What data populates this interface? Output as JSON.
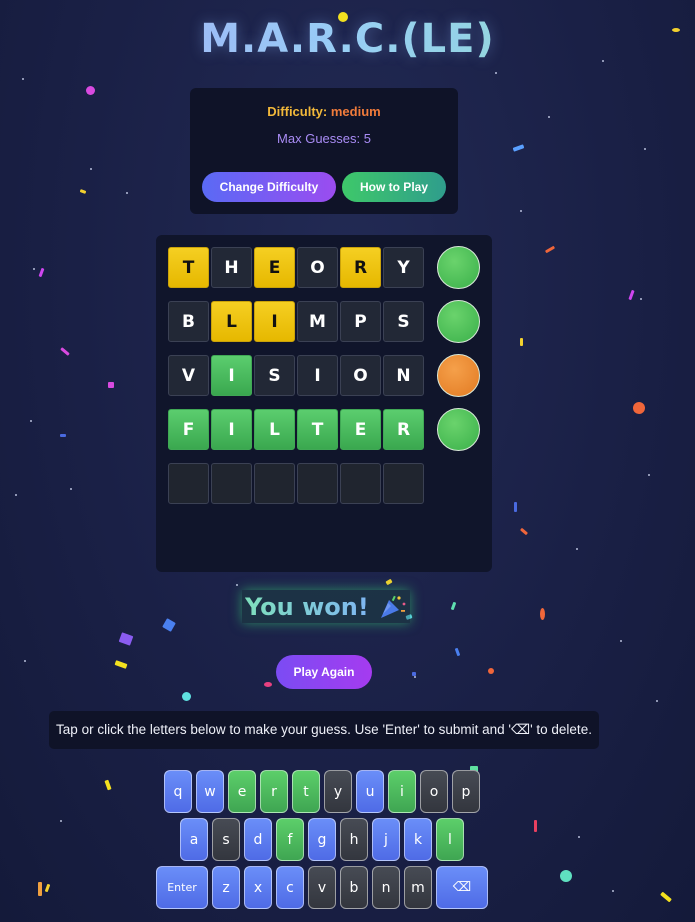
{
  "app": {
    "title": "M.A.R.C.(LE)"
  },
  "difficulty": {
    "label": "Difficulty:",
    "value": "medium",
    "max_guesses_text": "Max Guesses: 5",
    "change_button": "Change Difficulty",
    "how_button": "How to Play"
  },
  "board": {
    "rows": [
      {
        "letters": [
          "T",
          "H",
          "E",
          "O",
          "R",
          "Y"
        ],
        "states": [
          "y",
          "d",
          "y",
          "d",
          "y",
          "d"
        ],
        "indicator": "green"
      },
      {
        "letters": [
          "B",
          "L",
          "I",
          "M",
          "P",
          "S"
        ],
        "states": [
          "d",
          "y",
          "y",
          "d",
          "d",
          "d"
        ],
        "indicator": "green"
      },
      {
        "letters": [
          "V",
          "I",
          "S",
          "I",
          "O",
          "N"
        ],
        "states": [
          "d",
          "g",
          "d",
          "d",
          "d",
          "d"
        ],
        "indicator": "orange"
      },
      {
        "letters": [
          "F",
          "I",
          "L",
          "T",
          "E",
          "R"
        ],
        "states": [
          "g",
          "g",
          "g",
          "g",
          "g",
          "g"
        ],
        "indicator": "green"
      },
      {
        "letters": [
          "",
          "",
          "",
          "",
          "",
          ""
        ],
        "states": [
          "e",
          "e",
          "e",
          "e",
          "e",
          "e"
        ],
        "indicator": ""
      }
    ]
  },
  "result": {
    "message": "You won!",
    "icon": "party-popper-icon"
  },
  "play_again": "Play Again",
  "hint": "Tap or click the letters below to make your guess. Use 'Enter' to submit and '⌫' to delete.",
  "keyboard": {
    "rows": [
      [
        {
          "k": "q",
          "s": "b"
        },
        {
          "k": "w",
          "s": "b"
        },
        {
          "k": "e",
          "s": "g"
        },
        {
          "k": "r",
          "s": "g"
        },
        {
          "k": "t",
          "s": "g"
        },
        {
          "k": "y",
          "s": "d"
        },
        {
          "k": "u",
          "s": "b"
        },
        {
          "k": "i",
          "s": "g"
        },
        {
          "k": "o",
          "s": "d"
        },
        {
          "k": "p",
          "s": "d"
        }
      ],
      [
        {
          "k": "a",
          "s": "b"
        },
        {
          "k": "s",
          "s": "d"
        },
        {
          "k": "d",
          "s": "b"
        },
        {
          "k": "f",
          "s": "g"
        },
        {
          "k": "g",
          "s": "b"
        },
        {
          "k": "h",
          "s": "d"
        },
        {
          "k": "j",
          "s": "b"
        },
        {
          "k": "k",
          "s": "b"
        },
        {
          "k": "l",
          "s": "g"
        }
      ],
      [
        {
          "k": "Enter",
          "s": "b",
          "t": "enter"
        },
        {
          "k": "z",
          "s": "b"
        },
        {
          "k": "x",
          "s": "b"
        },
        {
          "k": "c",
          "s": "b"
        },
        {
          "k": "v",
          "s": "d"
        },
        {
          "k": "b",
          "s": "d"
        },
        {
          "k": "n",
          "s": "d"
        },
        {
          "k": "m",
          "s": "d"
        },
        {
          "k": "⌫",
          "s": "b",
          "t": "delete"
        }
      ]
    ]
  },
  "colors": {
    "yellow": "#f5cf22",
    "green": "#4cbd5e",
    "orange": "#f0923a",
    "blue_key": "#5d7df1",
    "dark_key": "#3d4048",
    "background": "#1a2046"
  }
}
